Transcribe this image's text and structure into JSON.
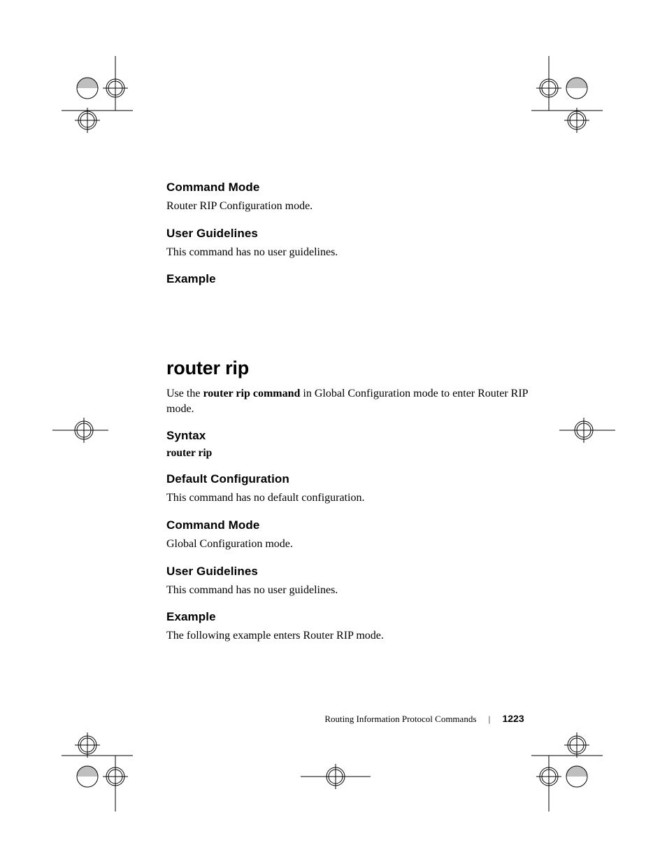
{
  "sections": {
    "command_mode_1": {
      "heading": "Command Mode",
      "body": "Router RIP Configuration mode."
    },
    "user_guidelines_1": {
      "heading": "User Guidelines",
      "body": "This command has no user guidelines."
    },
    "example_1": {
      "heading": "Example"
    },
    "router_rip": {
      "heading": "router rip",
      "intro_pre": "Use the ",
      "intro_bold": "router rip command",
      "intro_post": " in Global Configuration mode to enter Router RIP mode."
    },
    "syntax": {
      "heading": "Syntax",
      "line": "router rip"
    },
    "default_config": {
      "heading": "Default Configuration",
      "body": "This command has no default configuration."
    },
    "command_mode_2": {
      "heading": "Command Mode",
      "body": "Global Configuration mode."
    },
    "user_guidelines_2": {
      "heading": "User Guidelines",
      "body": "This command has no user guidelines."
    },
    "example_2": {
      "heading": "Example",
      "body": "The following example enters Router RIP mode."
    }
  },
  "footer": {
    "section_title": "Routing Information Protocol Commands",
    "page_number": "1223"
  }
}
